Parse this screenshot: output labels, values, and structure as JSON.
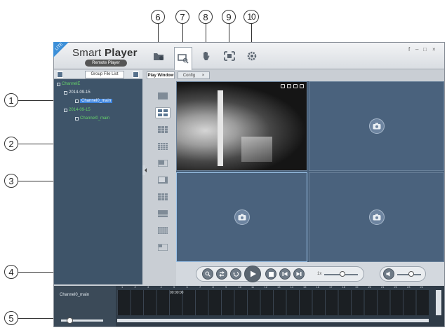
{
  "app": {
    "badge": "LITE",
    "title_normal": "Smart ",
    "title_bold": "Player",
    "subtitle": "Remote Player"
  },
  "window_controls": [
    "f",
    "–",
    "□",
    "×"
  ],
  "callouts": [
    "1",
    "2",
    "3",
    "4",
    "5",
    "6",
    "7",
    "8",
    "9",
    "10"
  ],
  "left_panel": {
    "header_label": "Group File List",
    "tree": [
      {
        "label": "ChannelE",
        "level": 0,
        "style": "green"
      },
      {
        "label": "2014-09-15",
        "level": 1,
        "style": "normal"
      },
      {
        "label": "Channel0_main",
        "level": 2,
        "style": "selected"
      },
      {
        "label": "2014-09-15",
        "level": 1,
        "style": "green"
      },
      {
        "label": "Channel0_main",
        "level": 2,
        "style": "green"
      }
    ]
  },
  "tabs": {
    "play_window": "Play Window",
    "config": "Config",
    "config_close": "×"
  },
  "controls": {
    "speed_label": "1x"
  },
  "timeline": {
    "channel_label": "Channel0_main",
    "marker": "00:00:00",
    "ticks": [
      "1",
      "2",
      "3",
      "4",
      "5",
      "6",
      "7",
      "8",
      "9",
      "10",
      "11",
      "12",
      "13",
      "14",
      "15",
      "16",
      "17",
      "18",
      "19",
      "20",
      "21",
      "22",
      "23",
      "24"
    ]
  },
  "colors": {
    "panel_bg": "#3e5469",
    "video_bg": "#48607a",
    "tree_green": "#66d36a",
    "selection_blue": "#3f86e0"
  }
}
